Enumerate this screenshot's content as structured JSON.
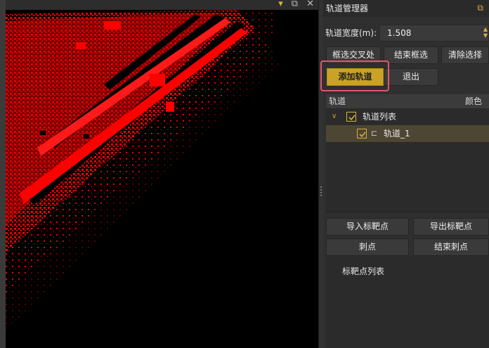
{
  "viewport": {
    "icons": [
      "pin-icon",
      "float-window-icon",
      "close-icon"
    ],
    "point_color": "#ff0000"
  },
  "panel": {
    "title": "轨道管理器",
    "width_label": "轨道宽度(m):",
    "width_value": "1.508",
    "buttons": {
      "box_select": "框选交叉处",
      "end_box": "结束框选",
      "clear_selection": "清除选择",
      "add_track": "添加轨道",
      "exit": "退出",
      "import_targets": "导入标靶点",
      "export_targets": "导出标靶点",
      "stab_point": "刺点",
      "end_stab": "结束刺点"
    },
    "tree": {
      "col_track": "轨道",
      "col_color": "颜色",
      "root_label": "轨道列表",
      "child_label": "轨道_1"
    },
    "target_list_title": "标靶点列表",
    "accent_color": "#c9a227"
  }
}
